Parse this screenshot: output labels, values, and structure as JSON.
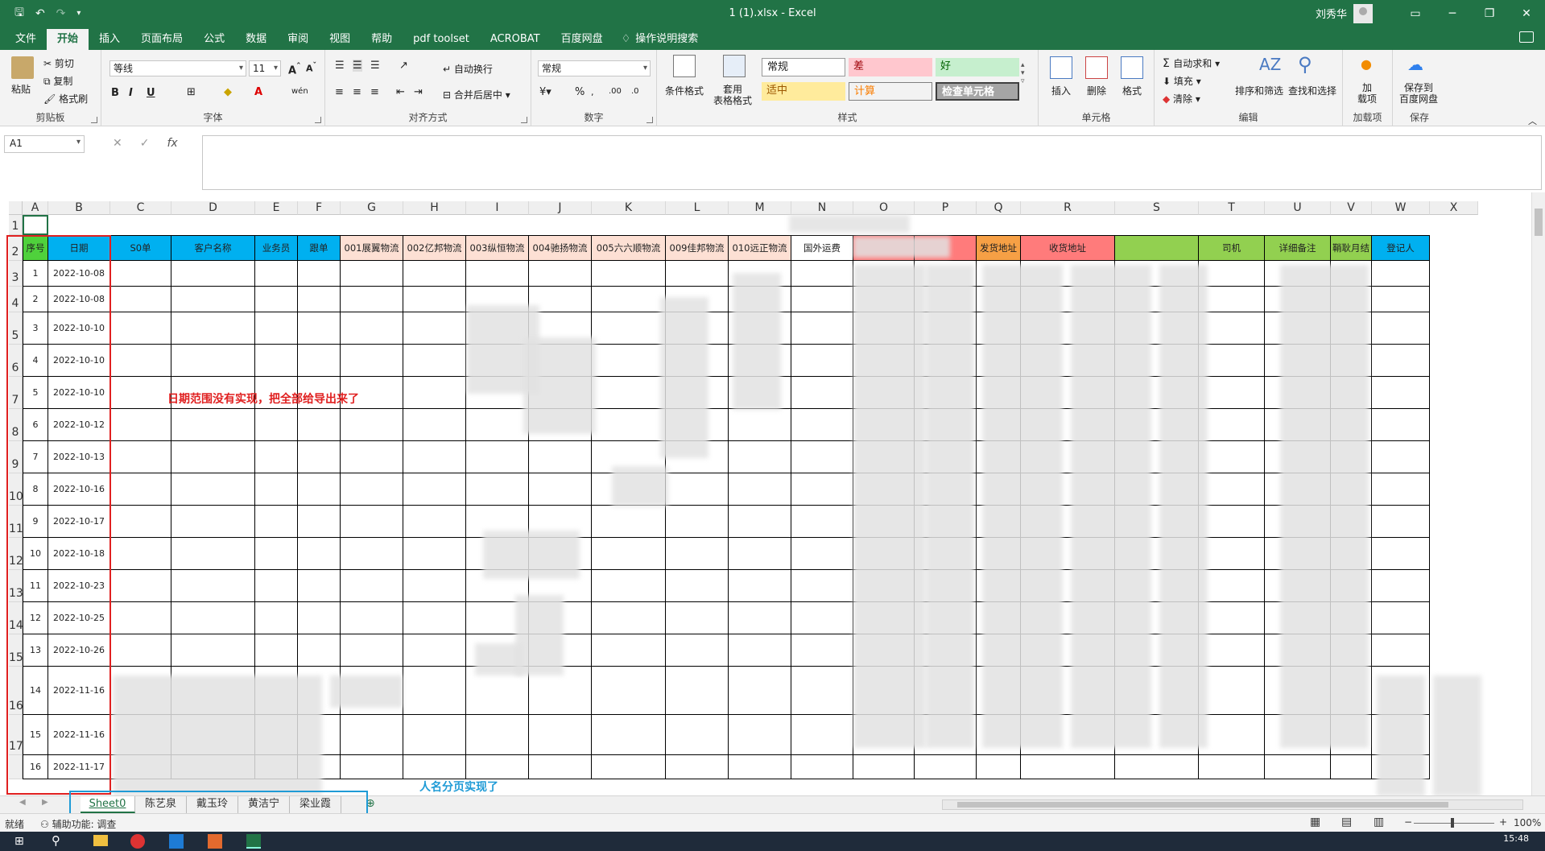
{
  "window": {
    "title": "1 (1).xlsx  -  Excel",
    "user": "刘秀华"
  },
  "tabs": [
    "文件",
    "开始",
    "插入",
    "页面布局",
    "公式",
    "数据",
    "审阅",
    "视图",
    "帮助",
    "pdf toolset",
    "ACROBAT",
    "百度网盘"
  ],
  "tell_me": "操作说明搜索",
  "ribbon": {
    "clipboard": {
      "paste": "粘贴",
      "cut": "剪切",
      "copy": "复制",
      "painter": "格式刷",
      "label": "剪贴板"
    },
    "font": {
      "name": "等线",
      "size": "11",
      "label": "字体",
      "bold": "B",
      "italic": "I",
      "underline": "U",
      "wen": "wén"
    },
    "align": {
      "wrap": "自动换行",
      "merge": "合并后居中",
      "label": "对齐方式"
    },
    "number": {
      "format": "常规",
      "label": "数字",
      "percent": "%"
    },
    "styles": {
      "cond": "条件格式",
      "table": "套用\n表格格式",
      "normal": "常规",
      "bad": "差",
      "good": "好",
      "neutral": "适中",
      "calc": "计算",
      "check": "检查单元格",
      "label": "样式"
    },
    "cells": {
      "insert": "插入",
      "delete": "删除",
      "format": "格式",
      "label": "单元格"
    },
    "editing": {
      "autosum": "自动求和",
      "fill": "填充",
      "clear": "清除",
      "sort": "排序和筛选",
      "find": "查找和选择",
      "label": "编辑"
    },
    "addins": {
      "load": "加\n载项",
      "label": "加载项"
    },
    "save": {
      "baidu": "保存到\n百度网盘",
      "label": "保存"
    }
  },
  "formula_bar": {
    "name_box": "A1",
    "fx": "fx"
  },
  "columns": [
    "A",
    "B",
    "C",
    "D",
    "E",
    "F",
    "G",
    "H",
    "I",
    "J",
    "K",
    "L",
    "M",
    "N",
    "O",
    "P",
    "Q",
    "R",
    "S",
    "T",
    "U",
    "V",
    "W",
    "X"
  ],
  "header_row": [
    "序号",
    "日期",
    "S0单",
    "客户名称",
    "业务员",
    "跟单",
    "001展翼物流",
    "002亿邦物流",
    "003纵恒物流",
    "004驰扬物流",
    "005六六顺物流",
    "009佳邦物流",
    "010远正物流",
    "国外运费",
    "",
    "",
    "发货地址",
    "收货地址",
    "",
    "司机",
    "详细备注",
    "鞘耿月结",
    "登记人"
  ],
  "rows": [
    {
      "row": "3",
      "seq": "1",
      "date": "2022-10-08"
    },
    {
      "row": "4",
      "seq": "2",
      "date": "2022-10-08"
    },
    {
      "row": "5",
      "seq": "3",
      "date": "2022-10-10"
    },
    {
      "row": "6",
      "seq": "4",
      "date": "2022-10-10"
    },
    {
      "row": "7",
      "seq": "5",
      "date": "2022-10-10"
    },
    {
      "row": "8",
      "seq": "6",
      "date": "2022-10-12"
    },
    {
      "row": "9",
      "seq": "7",
      "date": "2022-10-13"
    },
    {
      "row": "10",
      "seq": "8",
      "date": "2022-10-16"
    },
    {
      "row": "11",
      "seq": "9",
      "date": "2022-10-17"
    },
    {
      "row": "12",
      "seq": "10",
      "date": "2022-10-18"
    },
    {
      "row": "13",
      "seq": "11",
      "date": "2022-10-23"
    },
    {
      "row": "14",
      "seq": "12",
      "date": "2022-10-25"
    },
    {
      "row": "15",
      "seq": "13",
      "date": "2022-10-26"
    },
    {
      "row": "16",
      "seq": "14",
      "date": "2022-11-16"
    },
    {
      "row": "17",
      "seq": "15",
      "date": "2022-11-16"
    },
    {
      "row": "",
      "seq": "16",
      "date": "2022-11-17"
    }
  ],
  "annotations": {
    "red_note": "日期范围没有实现，把全部给导出来了",
    "blue_note": "人名分页实现了"
  },
  "sheets": [
    "Sheet0",
    "陈艺泉",
    "戴玉玲",
    "黄洁宁",
    "梁业霞"
  ],
  "status": {
    "ready": "就绪",
    "accessibility": "辅助功能: 调查",
    "zoom": "100%"
  },
  "taskbar": {
    "time": "15:48"
  },
  "colors": {
    "accent": "#217346",
    "red_box": "#e02020",
    "blue_box": "#1f9bd6"
  }
}
